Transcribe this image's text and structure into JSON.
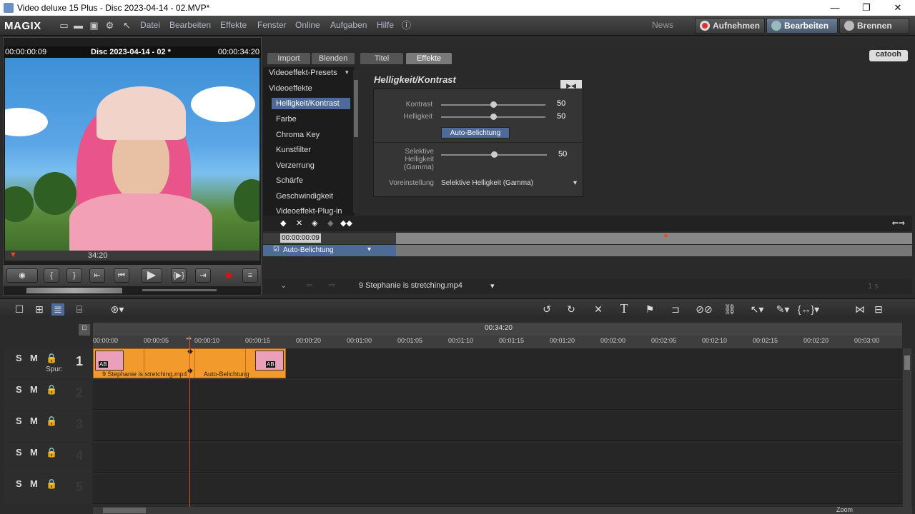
{
  "window": {
    "title": "Video deluxe 15 Plus - Disc 2023-04-14 - 02.MVP*",
    "minimize": "—",
    "maximize": "❐",
    "close": "✕"
  },
  "menubar": {
    "logo": "MAGIX",
    "menus": [
      "Datei",
      "Bearbeiten",
      "Effekte",
      "Fenster",
      "Online",
      "Aufgaben",
      "Hilfe"
    ],
    "news": "News",
    "modes": [
      "Aufnehmen",
      "Bearbeiten",
      "Brennen"
    ]
  },
  "preview": {
    "timecode_left": "00:00:00:09",
    "title": "Disc 2023-04-14 - 02 *",
    "timecode_right": "00:00:34:20",
    "scrub_time": "34:20"
  },
  "effects": {
    "tabs": [
      "Import",
      "Blenden",
      "Titel",
      "Effekte"
    ],
    "active_tab": "Effekte",
    "brand": "catooh",
    "categories": [
      {
        "label": "Videoeffekt-Presets",
        "type": "header"
      },
      {
        "label": "Videoeffekte",
        "type": "header"
      },
      {
        "label": "Helligkeit/Kontrast",
        "type": "selected"
      },
      {
        "label": "Farbe",
        "type": "sub"
      },
      {
        "label": "Chroma Key",
        "type": "sub"
      },
      {
        "label": "Kunstfilter",
        "type": "sub"
      },
      {
        "label": "Verzerrung",
        "type": "sub"
      },
      {
        "label": "Schärfe",
        "type": "sub"
      },
      {
        "label": "Geschwindigkeit",
        "type": "sub"
      },
      {
        "label": "Videoeffekt-Plug-in",
        "type": "sub"
      }
    ],
    "panel_title": "Helligkeit/Kontrast",
    "kontrast": {
      "label": "Kontrast",
      "value": "50",
      "level": 0.5
    },
    "helligkeit": {
      "label": "Helligkeit",
      "value": "50",
      "level": 0.5
    },
    "auto_button": "Auto-Belichtung",
    "selektive": {
      "label": "Selektive Helligkeit (Gamma)",
      "value": "50",
      "level": 0.5
    },
    "voreinstellung_label": "Voreinstellung",
    "voreinstellung_value": "Selektive Helligkeit (Gamma)",
    "kf_time": "00:00:00:09",
    "kf_track": "Auto-Belichtung",
    "clip_name": "9 Stephanie is stretching.mp4",
    "zoom_label": "1 s"
  },
  "timeline": {
    "total_time": "00:34:20",
    "ticks": [
      "00:00:00",
      "00:00:05",
      "00:00:10",
      "00:00:15",
      "00:00:20",
      "00:01:00",
      "00:01:05",
      "00:01:10",
      "00:01:15",
      "00:01:20",
      "00:02:00",
      "00:02:05",
      "00:02:10",
      "00:02:15",
      "00:02:20",
      "00:03:00"
    ],
    "track1_number": "1",
    "track1_label": "Spur:",
    "clip_label": "9 Stephanie is stretching.mp4",
    "clip_effect": "Auto-Belichtung",
    "track_numbers": [
      "2",
      "3",
      "4",
      "5"
    ],
    "zoom": "Zoom"
  },
  "colors": {
    "accent": "#4e6a98",
    "clip": "#f39a2c",
    "playhead": "#e05020",
    "record": "#e01010"
  }
}
